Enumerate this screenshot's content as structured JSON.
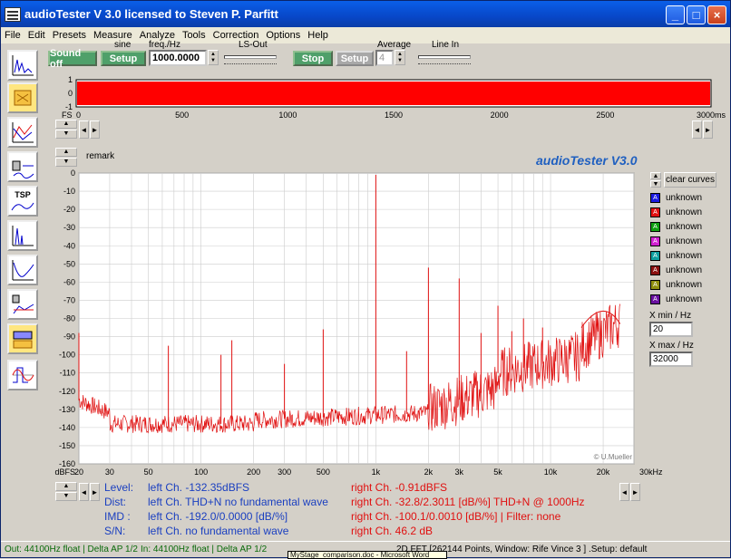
{
  "window": {
    "title": "audioTester  V 3.0   licensed to Steven P. Parfitt"
  },
  "menu": [
    "File",
    "Edit",
    "Presets",
    "Measure",
    "Analyze",
    "Tools",
    "Correction",
    "Options",
    "Help"
  ],
  "toolbar": {
    "sound_off": "Sound off",
    "setup1": "Setup",
    "sine_label": "sine",
    "freq_label": "freq./Hz",
    "freq_value": "1000.0000",
    "ls_out_label": "LS-Out",
    "stop": "Stop",
    "setup2": "Setup",
    "average_label": "Average",
    "average_value": "4",
    "line_in_label": "Line In"
  },
  "scope": {
    "yticks": [
      "1",
      "0",
      "-1"
    ],
    "fs_label": "FS",
    "xticks": [
      "0",
      "500",
      "1000",
      "1500",
      "2000",
      "2500",
      "3000ms"
    ],
    "color": "#ff0000"
  },
  "fft": {
    "remark": "remark",
    "brand": "audioTester  V3.0",
    "credit": "© U.Mueller",
    "yunit": "dBFS",
    "xunit": "30kHz",
    "yticks": [
      "0",
      "-10",
      "-20",
      "-30",
      "-40",
      "-50",
      "-60",
      "-70",
      "-80",
      "-90",
      "-100",
      "-110",
      "-120",
      "-130",
      "-140",
      "-150",
      "-160"
    ],
    "xticks": [
      "20",
      "30",
      "50",
      "100",
      "200",
      "300",
      "500",
      "1k",
      "2k",
      "3k",
      "5k",
      "10k",
      "20k"
    ],
    "trace_color": "#e01010"
  },
  "legend": {
    "clear": "clear curves",
    "items": [
      {
        "letter": "A",
        "label": "unknown",
        "color": "#1a1ae0"
      },
      {
        "letter": "A",
        "label": "unknown",
        "color": "#e01010"
      },
      {
        "letter": "A",
        "label": "unknown",
        "color": "#10a010"
      },
      {
        "letter": "A",
        "label": "unknown",
        "color": "#d020d0"
      },
      {
        "letter": "A",
        "label": "unknown",
        "color": "#10a0a0"
      },
      {
        "letter": "A",
        "label": "unknown",
        "color": "#8a1010"
      },
      {
        "letter": "A",
        "label": "unknown",
        "color": "#909010"
      },
      {
        "letter": "A",
        "label": "unknown",
        "color": "#6a10a0"
      }
    ],
    "xmin_label": "X min / Hz",
    "xmin_value": "20",
    "xmax_label": "X max / Hz",
    "xmax_value": "32000"
  },
  "readout": {
    "level_label": "Level:",
    "level_left": "left Ch. -132.35dBFS",
    "level_right": "right Ch. -0.91dBFS",
    "dist_label": "Dist:",
    "dist_left": "left Ch. THD+N  no fundamental wave",
    "dist_right": "right Ch. -32.8/2.3011 [dB/%] THD+N  @ 1000Hz",
    "imd_label": "IMD  :",
    "imd_left": "left Ch. -192.0/0.0000 [dB/%]",
    "imd_right": "right Ch. -100.1/0.0010 [dB/%] |   Filter: none",
    "sn_label": "S/N:",
    "sn_left": "left Ch.  no fundamental wave",
    "sn_right": "right Ch. 46.2 dB"
  },
  "status": {
    "out": "Out: 44100Hz float  | Delta AP 1/2",
    "in": "In: 44100Hz float  | Delta AP 1/2",
    "fft": "2D FFT [262144 Points, Window: Rife Vince 3 ] .Setup:  default",
    "hint": "MyStage_comparison.doc - Microsoft Word"
  },
  "sidebar": {
    "tsp_label": "TSP"
  }
}
